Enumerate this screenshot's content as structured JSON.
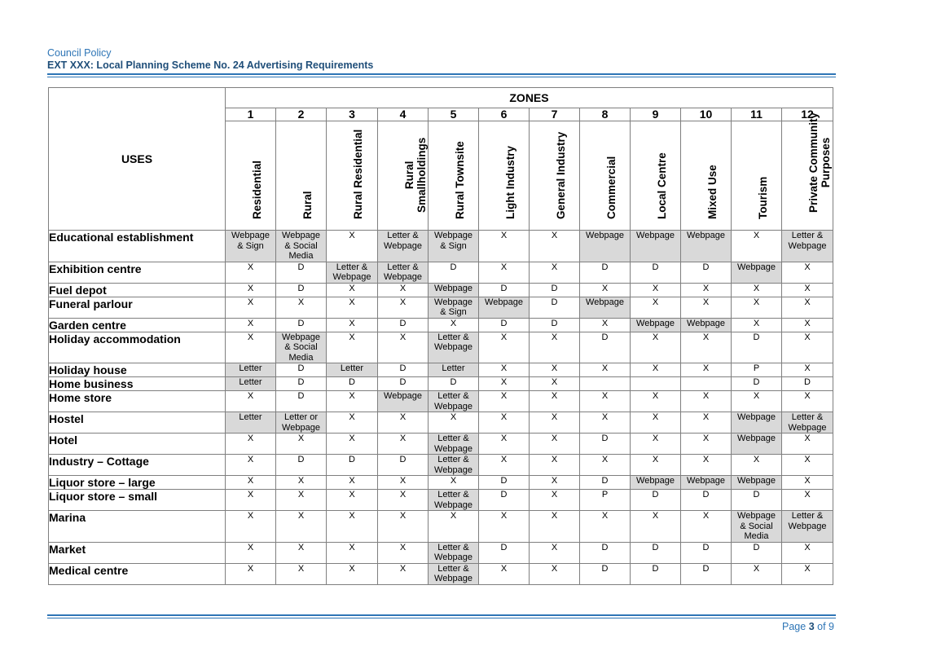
{
  "header": {
    "line1": "Council Policy",
    "line2": "EXT XXX: Local Planning Scheme No. 24 Advertising Requirements"
  },
  "table": {
    "uses_label": "USES",
    "zones_label": "ZONES",
    "zones": [
      {
        "num": "1",
        "name": "Residential"
      },
      {
        "num": "2",
        "name": "Rural"
      },
      {
        "num": "3",
        "name": "Rural Residential"
      },
      {
        "num": "4",
        "name": "Rural\nSmallholdings"
      },
      {
        "num": "5",
        "name": "Rural Townsite"
      },
      {
        "num": "6",
        "name": "Light Industry"
      },
      {
        "num": "7",
        "name": "General Industry"
      },
      {
        "num": "8",
        "name": "Commercial"
      },
      {
        "num": "9",
        "name": "Local Centre"
      },
      {
        "num": "10",
        "name": "Mixed Use"
      },
      {
        "num": "11",
        "name": "Tourism"
      },
      {
        "num": "12",
        "name": "Private Community\nPurposes"
      }
    ],
    "rows": [
      {
        "use": "Educational establishment",
        "cells": [
          {
            "v": "Webpage\n& Sign",
            "s": true
          },
          {
            "v": "Webpage\n& Social\nMedia",
            "s": true
          },
          {
            "v": "X"
          },
          {
            "v": "Letter &\nWebpage",
            "s": true
          },
          {
            "v": "Webpage\n& Sign",
            "s": true
          },
          {
            "v": "X"
          },
          {
            "v": "X"
          },
          {
            "v": "Webpage",
            "s": true
          },
          {
            "v": "Webpage",
            "s": true
          },
          {
            "v": "Webpage",
            "s": true
          },
          {
            "v": "X"
          },
          {
            "v": "Letter &\nWebpage",
            "s": true
          }
        ]
      },
      {
        "use": "Exhibition centre",
        "cells": [
          {
            "v": "X"
          },
          {
            "v": "D"
          },
          {
            "v": "Letter &\nWebpage",
            "s": true
          },
          {
            "v": "Letter &\nWebpage",
            "s": true
          },
          {
            "v": "D"
          },
          {
            "v": "X"
          },
          {
            "v": "X"
          },
          {
            "v": "D"
          },
          {
            "v": "D"
          },
          {
            "v": "D"
          },
          {
            "v": "Webpage",
            "s": true
          },
          {
            "v": "X"
          }
        ]
      },
      {
        "use": "Fuel depot",
        "cells": [
          {
            "v": "X"
          },
          {
            "v": "D"
          },
          {
            "v": "X"
          },
          {
            "v": "X"
          },
          {
            "v": "Webpage",
            "s": true
          },
          {
            "v": "D"
          },
          {
            "v": "D"
          },
          {
            "v": "X"
          },
          {
            "v": "X"
          },
          {
            "v": "X"
          },
          {
            "v": "X"
          },
          {
            "v": "X"
          }
        ]
      },
      {
        "use": "Funeral parlour",
        "cells": [
          {
            "v": "X"
          },
          {
            "v": "X"
          },
          {
            "v": "X"
          },
          {
            "v": "X"
          },
          {
            "v": "Webpage\n& Sign",
            "s": true
          },
          {
            "v": "Webpage",
            "s": true
          },
          {
            "v": "D"
          },
          {
            "v": "Webpage",
            "s": true
          },
          {
            "v": "X"
          },
          {
            "v": "X"
          },
          {
            "v": "X"
          },
          {
            "v": "X"
          }
        ]
      },
      {
        "use": "Garden centre",
        "cells": [
          {
            "v": "X"
          },
          {
            "v": "D"
          },
          {
            "v": "X"
          },
          {
            "v": "D"
          },
          {
            "v": "X"
          },
          {
            "v": "D"
          },
          {
            "v": "D"
          },
          {
            "v": "X"
          },
          {
            "v": "Webpage",
            "s": true
          },
          {
            "v": "Webpage",
            "s": true
          },
          {
            "v": "X"
          },
          {
            "v": "X"
          }
        ]
      },
      {
        "use": "Holiday accommodation",
        "cells": [
          {
            "v": "X"
          },
          {
            "v": "Webpage\n& Social\nMedia",
            "s": true
          },
          {
            "v": "X"
          },
          {
            "v": "X"
          },
          {
            "v": "Letter &\nWebpage",
            "s": true
          },
          {
            "v": "X"
          },
          {
            "v": "X"
          },
          {
            "v": "D"
          },
          {
            "v": "X"
          },
          {
            "v": "X"
          },
          {
            "v": "D"
          },
          {
            "v": "X"
          }
        ]
      },
      {
        "use": "Holiday house",
        "cells": [
          {
            "v": "Letter",
            "s": true
          },
          {
            "v": "D"
          },
          {
            "v": "Letter",
            "s": true
          },
          {
            "v": "D"
          },
          {
            "v": "Letter",
            "s": true
          },
          {
            "v": "X"
          },
          {
            "v": "X"
          },
          {
            "v": "X"
          },
          {
            "v": "X"
          },
          {
            "v": "X"
          },
          {
            "v": "P"
          },
          {
            "v": "X"
          }
        ]
      },
      {
        "use": "Home business",
        "cells": [
          {
            "v": "Letter",
            "s": true
          },
          {
            "v": "D"
          },
          {
            "v": "D"
          },
          {
            "v": "D"
          },
          {
            "v": "D"
          },
          {
            "v": "X"
          },
          {
            "v": "X"
          },
          {
            "v": ""
          },
          {
            "v": ""
          },
          {
            "v": ""
          },
          {
            "v": "D"
          },
          {
            "v": "D"
          }
        ]
      },
      {
        "use": "Home store",
        "cells": [
          {
            "v": "X"
          },
          {
            "v": "D"
          },
          {
            "v": "X"
          },
          {
            "v": "Webpage",
            "s": true
          },
          {
            "v": "Letter &\nWebpage",
            "s": true
          },
          {
            "v": "X"
          },
          {
            "v": "X"
          },
          {
            "v": "X"
          },
          {
            "v": "X"
          },
          {
            "v": "X"
          },
          {
            "v": "X"
          },
          {
            "v": "X"
          }
        ]
      },
      {
        "use": "Hostel",
        "cells": [
          {
            "v": "Letter",
            "s": true
          },
          {
            "v": "Letter or\nWebpage",
            "s": true
          },
          {
            "v": "X"
          },
          {
            "v": "X"
          },
          {
            "v": "X"
          },
          {
            "v": "X"
          },
          {
            "v": "X"
          },
          {
            "v": "X"
          },
          {
            "v": "X"
          },
          {
            "v": "X"
          },
          {
            "v": "Webpage",
            "s": true
          },
          {
            "v": "Letter &\nWebpage",
            "s": true
          }
        ]
      },
      {
        "use": "Hotel",
        "cells": [
          {
            "v": "X"
          },
          {
            "v": "X"
          },
          {
            "v": "X"
          },
          {
            "v": "X"
          },
          {
            "v": "Letter &\nWebpage",
            "s": true
          },
          {
            "v": "X"
          },
          {
            "v": "X"
          },
          {
            "v": "D"
          },
          {
            "v": "X"
          },
          {
            "v": "X"
          },
          {
            "v": "Webpage",
            "s": true
          },
          {
            "v": "X"
          }
        ]
      },
      {
        "use": "Industry – Cottage",
        "cells": [
          {
            "v": "X"
          },
          {
            "v": "D"
          },
          {
            "v": "D"
          },
          {
            "v": "D"
          },
          {
            "v": "Letter &\nWebpage",
            "s": true
          },
          {
            "v": "X"
          },
          {
            "v": "X"
          },
          {
            "v": "X"
          },
          {
            "v": "X"
          },
          {
            "v": "X"
          },
          {
            "v": "X"
          },
          {
            "v": "X"
          }
        ]
      },
      {
        "use": "Liquor store – large",
        "cells": [
          {
            "v": "X"
          },
          {
            "v": "X"
          },
          {
            "v": "X"
          },
          {
            "v": "X"
          },
          {
            "v": "X"
          },
          {
            "v": "D"
          },
          {
            "v": "X"
          },
          {
            "v": "D"
          },
          {
            "v": "Webpage",
            "s": true
          },
          {
            "v": "Webpage",
            "s": true
          },
          {
            "v": "Webpage",
            "s": true
          },
          {
            "v": "X"
          }
        ]
      },
      {
        "use": "Liquor store – small",
        "cells": [
          {
            "v": "X"
          },
          {
            "v": "X"
          },
          {
            "v": "X"
          },
          {
            "v": "X"
          },
          {
            "v": "Letter &\nWebpage",
            "s": true
          },
          {
            "v": "D"
          },
          {
            "v": "X"
          },
          {
            "v": "P"
          },
          {
            "v": "D"
          },
          {
            "v": "D"
          },
          {
            "v": "D"
          },
          {
            "v": "X"
          }
        ]
      },
      {
        "use": "Marina",
        "cells": [
          {
            "v": "X"
          },
          {
            "v": "X"
          },
          {
            "v": "X"
          },
          {
            "v": "X"
          },
          {
            "v": "X"
          },
          {
            "v": "X"
          },
          {
            "v": "X"
          },
          {
            "v": "X"
          },
          {
            "v": "X"
          },
          {
            "v": "X"
          },
          {
            "v": "Webpage\n& Social\nMedia",
            "s": true
          },
          {
            "v": "Letter &\nWebpage",
            "s": true
          }
        ]
      },
      {
        "use": "Market",
        "cells": [
          {
            "v": "X"
          },
          {
            "v": "X"
          },
          {
            "v": "X"
          },
          {
            "v": "X"
          },
          {
            "v": "Letter &\nWebpage",
            "s": true
          },
          {
            "v": "D"
          },
          {
            "v": "X"
          },
          {
            "v": "D"
          },
          {
            "v": "D"
          },
          {
            "v": "D"
          },
          {
            "v": "D"
          },
          {
            "v": "X"
          }
        ]
      },
      {
        "use": "Medical centre",
        "cells": [
          {
            "v": "X"
          },
          {
            "v": "X"
          },
          {
            "v": "X"
          },
          {
            "v": "X"
          },
          {
            "v": "Letter &\nWebpage",
            "s": true
          },
          {
            "v": "X"
          },
          {
            "v": "X"
          },
          {
            "v": "D"
          },
          {
            "v": "D"
          },
          {
            "v": "D"
          },
          {
            "v": "X"
          },
          {
            "v": "X"
          }
        ]
      }
    ]
  },
  "footer": {
    "page_prefix": "Page",
    "page_current": "3",
    "page_suffix": "of 9"
  }
}
